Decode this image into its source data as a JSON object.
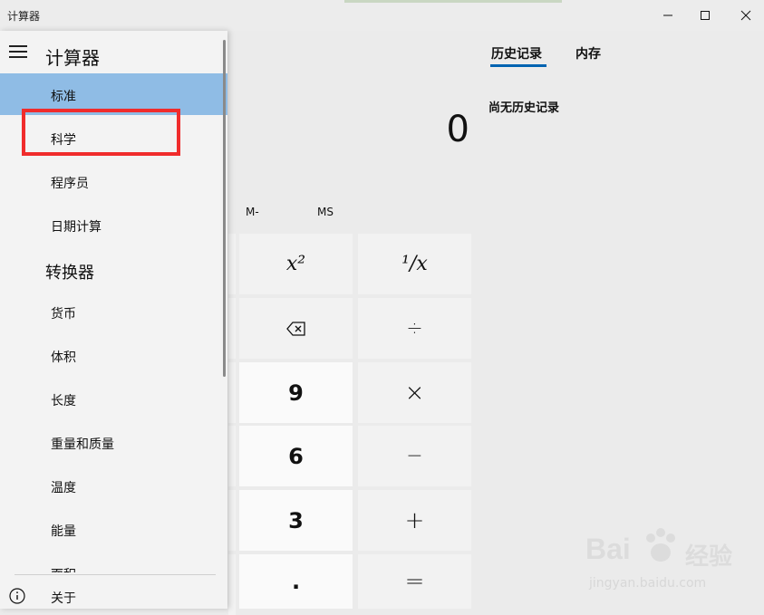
{
  "window": {
    "title": "计算器"
  },
  "drawer": {
    "title": "计算器",
    "calculator_items": [
      {
        "label": "标准",
        "selected": true
      },
      {
        "label": "科学",
        "selected": false
      },
      {
        "label": "程序员",
        "selected": false
      },
      {
        "label": "日期计算",
        "selected": false
      }
    ],
    "converter_title": "转换器",
    "converter_items": [
      {
        "label": "货币"
      },
      {
        "label": "体积"
      },
      {
        "label": "长度"
      },
      {
        "label": "重量和质量"
      },
      {
        "label": "温度"
      },
      {
        "label": "能量"
      },
      {
        "label": "面积"
      }
    ],
    "about_label": "关于"
  },
  "display": {
    "value": "0"
  },
  "memory": {
    "minus_label": "M-",
    "store_label": "MS"
  },
  "keys": {
    "square": "x²",
    "reciprocal": "¹/x",
    "backspace_icon": "backspace-icon",
    "divide": "÷",
    "nine": "9",
    "multiply": "×",
    "six": "6",
    "minus": "−",
    "three": "3",
    "plus": "+",
    "decimal": ".",
    "equals": "="
  },
  "history": {
    "tab_history": "历史记录",
    "tab_memory": "内存",
    "empty_text": "尚无历史记录"
  },
  "watermark": {
    "brand": "Bai",
    "brand_cn": "经验",
    "url": "jingyan.baidu.com"
  },
  "colors": {
    "selected_nav": "#8fbce5",
    "highlight": "#f02c2c",
    "accent": "#0063b1"
  }
}
